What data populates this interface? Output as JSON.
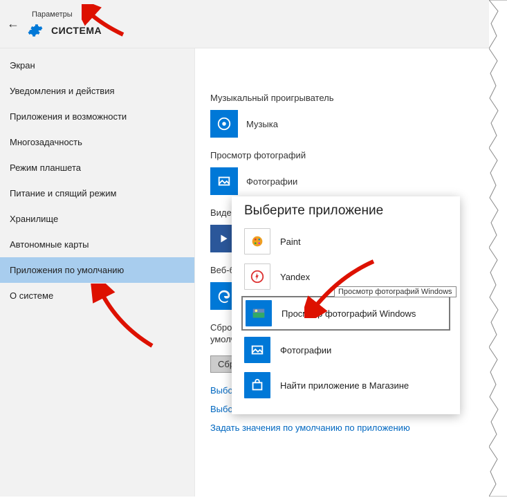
{
  "header": {
    "params_label": "Параметры",
    "title": "СИСТЕМА"
  },
  "sidebar": {
    "items": [
      {
        "label": "Экран"
      },
      {
        "label": "Уведомления и действия"
      },
      {
        "label": "Приложения и возможности"
      },
      {
        "label": "Многозадачность"
      },
      {
        "label": "Режим планшета"
      },
      {
        "label": "Питание и спящий режим"
      },
      {
        "label": "Хранилище"
      },
      {
        "label": "Автономные карты"
      },
      {
        "label": "Приложения по умолчанию"
      },
      {
        "label": "О системе"
      }
    ],
    "selected_index": 8
  },
  "main": {
    "music": {
      "section": "Музыкальный проигрыватель",
      "app": "Музыка"
    },
    "photos": {
      "section": "Просмотр фотографий",
      "app": "Фотографии"
    },
    "video": {
      "section_partial": "Виде"
    },
    "web": {
      "section_partial": "Веб-б"
    },
    "reset": {
      "section_partial_1": "Сброс",
      "section_partial_2": "умолч",
      "button_partial": "Сбр"
    },
    "link_partial": "Выбор",
    "link_protocols": "Выбор стандартных приложений для протоколов",
    "link_by_app": "Задать значения по умолчанию по приложению"
  },
  "popup": {
    "title": "Выберите приложение",
    "items": [
      {
        "label": "Paint"
      },
      {
        "label": "Yandex"
      },
      {
        "label": "Просмотр фотографий Windows"
      },
      {
        "label": "Фотографии"
      },
      {
        "label": "Найти приложение в Магазине"
      }
    ],
    "highlight_index": 2,
    "tooltip": "Просмотр фотографий Windows"
  }
}
